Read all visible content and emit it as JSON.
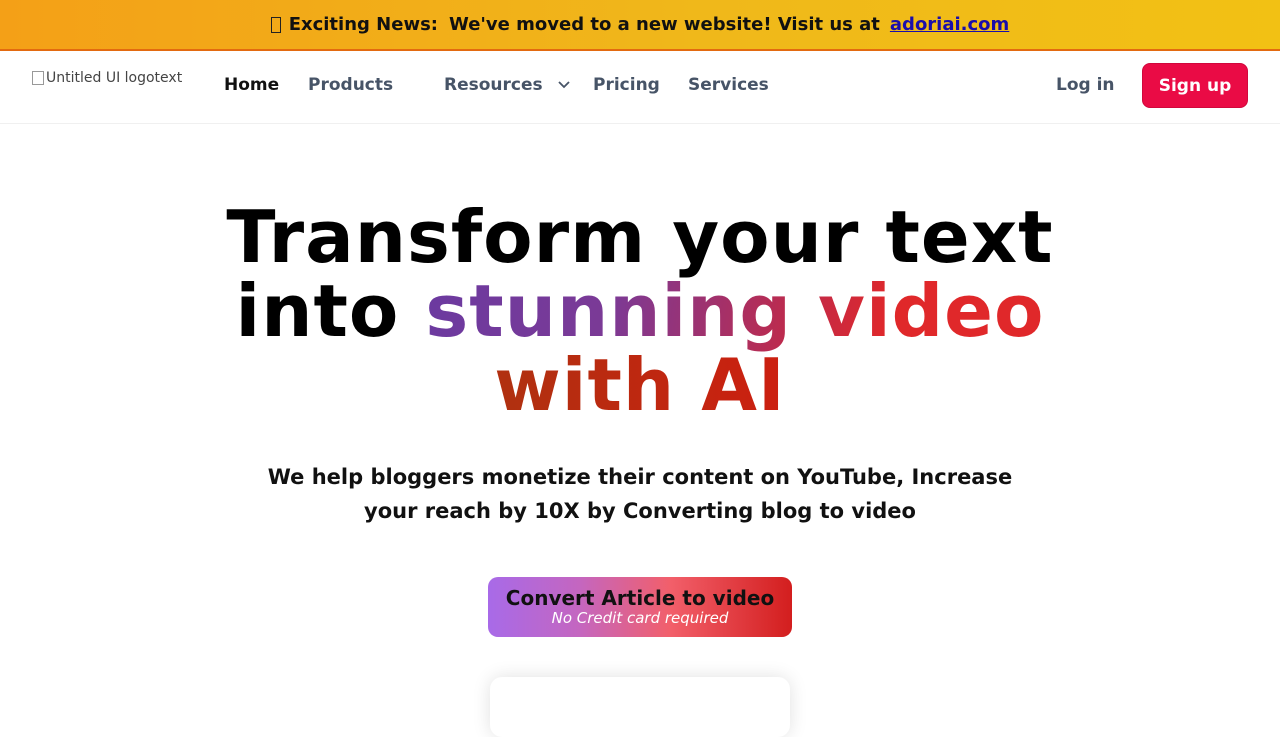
{
  "banner": {
    "lead": "Exciting News:",
    "message": "We've moved to a new website! Visit us at",
    "link": "adoriai.com"
  },
  "nav": {
    "logo_alt": "Untitled UI logotext",
    "links": [
      "Home",
      "Products",
      "Resources",
      "Pricing",
      "Services"
    ],
    "login": "Log in",
    "signup": "Sign up"
  },
  "hero": {
    "line1": "Transform your text",
    "line2_plain": "into ",
    "line2_gradient": "stunning video",
    "line3": "with AI",
    "subtitle": "We help bloggers monetize their content on YouTube, Increase your reach by 10X by Converting blog to video",
    "cta_main": "Convert Article to video",
    "cta_sub": "No Credit card required"
  }
}
